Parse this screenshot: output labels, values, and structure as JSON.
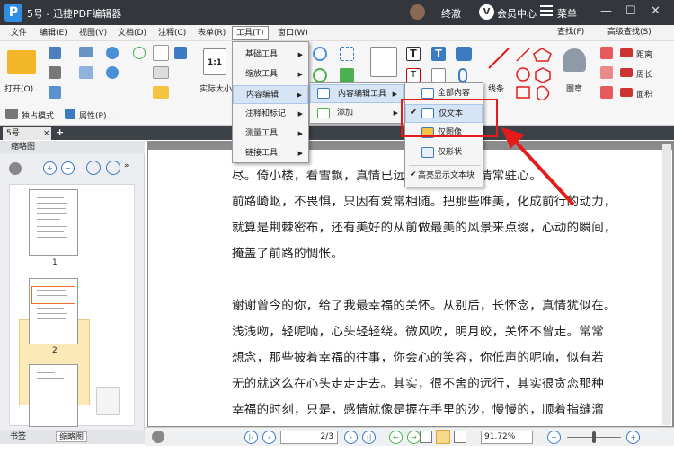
{
  "titlebar": {
    "title": "5号 - 迅捷PDF编辑器",
    "user": "终澈",
    "vip_label": "会员中心",
    "menu_label": "菜单",
    "logo": "P"
  },
  "menubar": {
    "items": [
      "文件",
      "编辑(E)",
      "视图(V)",
      "文档(D)",
      "注释(C)",
      "表单(R)",
      "工具(T)",
      "窗口(W)"
    ]
  },
  "toolbar": {
    "open_label": "打开(O)...",
    "actual_size_label": "实际大小",
    "exclusive_mode_label": "独占模式",
    "properties_label": "属性(P)...",
    "find_label": "查找(F)",
    "advanced_find_label": "高级查找(S)",
    "distance_label": "距离",
    "perimeter_label": "周长",
    "area_label": "面积",
    "stamp_label": "图章",
    "line_label": "线条"
  },
  "tab": {
    "name": "5号",
    "close": "×",
    "plus": "+"
  },
  "sidebar": {
    "header": "缩略图",
    "pages": [
      "1",
      "2"
    ],
    "bottom_tabs": [
      "书签",
      "缩略图"
    ]
  },
  "tools_menu": {
    "items": [
      "基础工具",
      "缩放工具",
      "内容编辑",
      "注释和标记",
      "测量工具",
      "链接工具"
    ]
  },
  "content_edit_menu": {
    "items": [
      "内容编辑工具",
      "添加"
    ]
  },
  "content_tool_menu": {
    "items": [
      "全部内容",
      "仅文本",
      "仅图像",
      "仅形状",
      "高亮显示文本块"
    ]
  },
  "document": {
    "lines": [
      "尽。倚小楼，看雪飘，真情已远逝，曾伤，深情常驻心。",
      "前路崎岖，不畏惧，只因有爱常相随。把那些唯美，化成前行的动力，",
      "就算是荆棘密布，还有美好的从前做最美的风景来点缀，心动的瞬间，",
      "掩盖了前路的惆怅。",
      "谢谢曾今的你，给了我最幸福的关怀。从别后，长怀念，真情犹似在。",
      "浅浅吻，轻呢喃，心头轻轻绕。微风吹，明月皎，关怀不曾走。常常",
      "想念，那些披着幸福的往事，你会心的笑容，你低声的呢喃，似有若",
      "无的就这么在心头走走走去。其实，很不舍的远行，其实很贪恋那种",
      "幸福的时刻，只是，感情就像是握在手里的沙，慢慢的，顺着指缝溜"
    ]
  },
  "statusbar": {
    "page_value": "2/3",
    "zoom_value": "91.72%"
  },
  "colors": {
    "accent": "#e31b1b",
    "titlebar": "#33373d",
    "menu_highlight": "#d6e5f5"
  }
}
